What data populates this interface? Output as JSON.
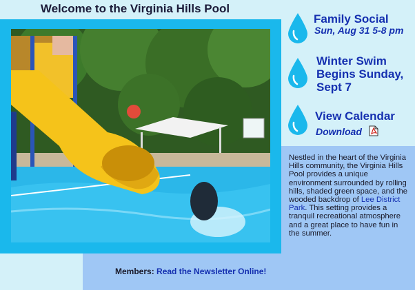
{
  "page_title": "Welcome to the Virginia Hills Pool",
  "notices": [
    {
      "title": "Family Social",
      "subtitle": "Sun, Aug 31 5-8 pm"
    },
    {
      "title": "Winter Swim Begins Sunday, Sept 7"
    },
    {
      "title": "View Calendar",
      "subtitle": "Download"
    }
  ],
  "description": {
    "text_before": "Nestled in the heart of the Virginia Hills community, the Virginia Hills Pool provides a unique environment surrounded by rolling hills, shaded green space, and the wooded backdrop of ",
    "link": "Lee District Park",
    "text_after": ". This setting provides a tranquil recreational atmosphere and a great place to have fun in the summer."
  },
  "members": {
    "label": "Members:",
    "link": "Read the Newsletter Online!"
  },
  "icons": [
    "water-drop-icon",
    "pdf-icon"
  ],
  "colors": {
    "accent": "#1ab8ec",
    "light_panel": "#d4f1f9",
    "dark_panel": "#9fc7f5",
    "link": "#1530b0"
  }
}
